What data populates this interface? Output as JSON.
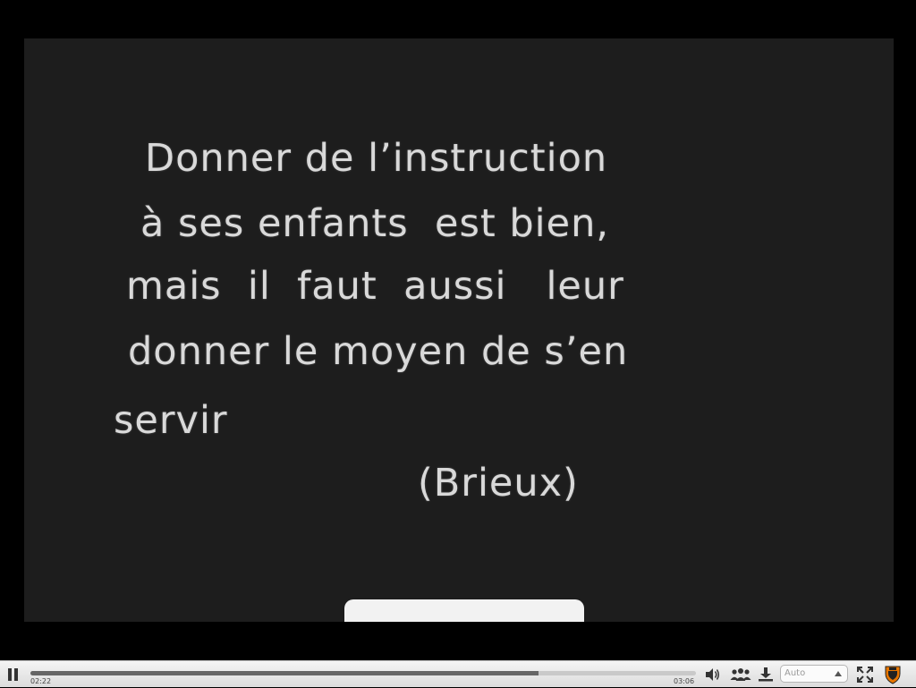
{
  "video": {
    "title_card": {
      "lines": [
        "Donner de l’instruction",
        "à ses enfants  est bien,",
        "mais  il  faut  aussi   leur",
        "donner le moyen de s’en",
        "servir",
        "(Brieux)"
      ]
    }
  },
  "controls": {
    "current_time": "02:22",
    "duration": "03:06",
    "progress_fraction": 0.763,
    "quality": {
      "selected": "Auto"
    },
    "icons": {
      "play_pause": "pause-icon",
      "volume": "volume-icon",
      "share": "people-icon",
      "download": "download-icon",
      "fullscreen": "fullscreen-icon",
      "brand": "shield-logo-icon"
    },
    "colors": {
      "bar_background": "#e6e6e6",
      "progress_fill": "#666666",
      "brand_orange": "#e77500"
    }
  }
}
